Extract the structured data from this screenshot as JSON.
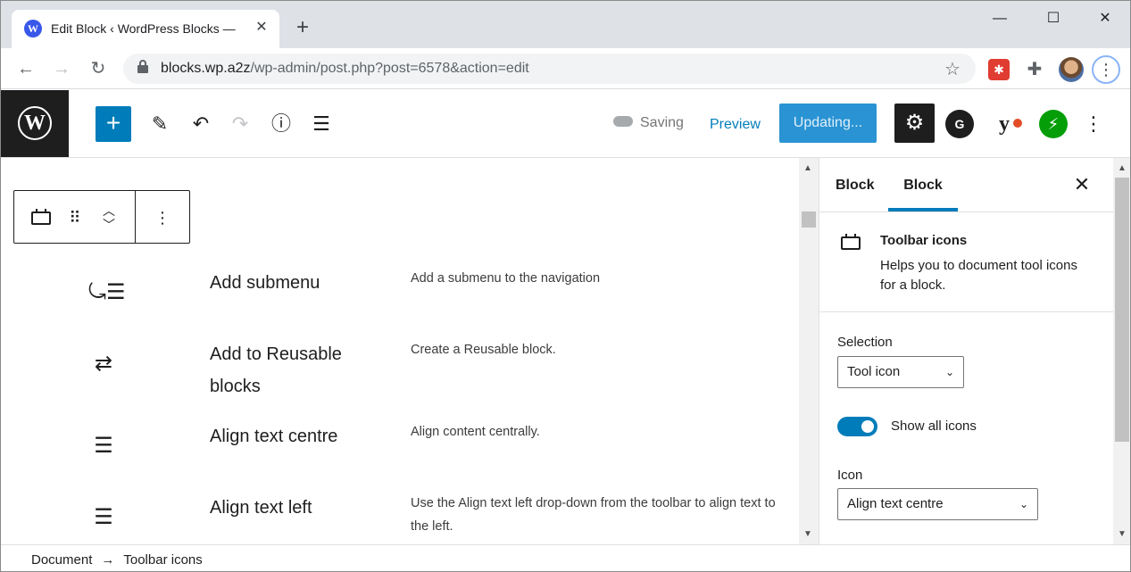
{
  "browser": {
    "tab_title": "Edit Block ‹ WordPress Blocks —",
    "url_host": "blocks.wp.a2z",
    "url_path": "/wp-admin/post.php?post=6578&action=edit"
  },
  "header": {
    "saving_label": "Saving",
    "preview_label": "Preview",
    "update_label": "Updating..."
  },
  "rows": [
    {
      "icon": "add-submenu-icon",
      "name": "Add submenu",
      "desc": "Add a submenu to the navigation"
    },
    {
      "icon": "reusable-icon",
      "name": "Add to Reusable blocks",
      "desc": "Create a Reusable block."
    },
    {
      "icon": "align-center-icon",
      "name": "Align text centre",
      "desc": "Align content centrally."
    },
    {
      "icon": "align-left-icon",
      "name": "Align text left",
      "desc": "Use the Align text left drop-down from the toolbar to align text to the left."
    }
  ],
  "sidebar": {
    "tabs": [
      "Block",
      "Block"
    ],
    "block_title": "Toolbar icons",
    "block_desc": "Helps you to document tool icons for a block.",
    "selection_label": "Selection",
    "selection_value": "Tool icon",
    "toggle_label": "Show all icons",
    "toggle_on": true,
    "icon_label": "Icon",
    "icon_value": "Align text centre"
  },
  "footer": {
    "crumb_root": "Document",
    "crumb_sep": "→",
    "crumb_current": "Toolbar icons"
  }
}
